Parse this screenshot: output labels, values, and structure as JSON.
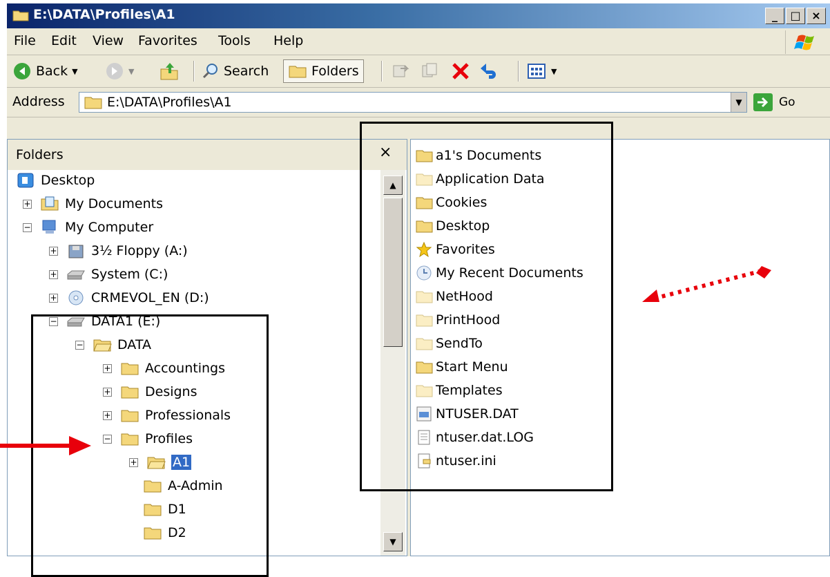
{
  "window": {
    "title": "E:\\DATA\\Profiles\\A1",
    "controls": {
      "minimize": "_",
      "maximize": "□",
      "close": "×"
    }
  },
  "menu": [
    "File",
    "Edit",
    "View",
    "Favorites",
    "Tools",
    "Help"
  ],
  "toolbar": {
    "back_label": "Back",
    "search_label": "Search",
    "folders_label": "Folders"
  },
  "address": {
    "label": "Address",
    "value": "E:\\DATA\\Profiles\\A1",
    "go_label": "Go"
  },
  "folder_pane": {
    "title": "Folders",
    "close": "×",
    "tree": [
      {
        "label": "Desktop",
        "icon": "desktop-icon",
        "expander": ""
      },
      {
        "label": "My Documents",
        "icon": "my-documents-icon",
        "expander": "+"
      },
      {
        "label": "My Computer",
        "icon": "my-computer-icon",
        "expander": "−"
      },
      {
        "label": "3½ Floppy (A:)",
        "icon": "floppy-icon",
        "expander": "+"
      },
      {
        "label": "System (C:)",
        "icon": "drive-icon",
        "expander": "+"
      },
      {
        "label": "CRMEVOL_EN (D:)",
        "icon": "cd-drive-icon",
        "expander": "+"
      },
      {
        "label": "DATA1 (E:)",
        "icon": "drive-icon",
        "expander": "−"
      },
      {
        "label": "DATA",
        "icon": "open-folder-icon",
        "expander": "−"
      },
      {
        "label": "Accountings",
        "icon": "folder-icon",
        "expander": "+"
      },
      {
        "label": "Designs",
        "icon": "folder-icon",
        "expander": "+"
      },
      {
        "label": "Professionals",
        "icon": "folder-icon",
        "expander": "+"
      },
      {
        "label": "Profiles",
        "icon": "folder-icon",
        "expander": "−"
      },
      {
        "label": "A1",
        "icon": "open-folder-icon",
        "expander": "+",
        "selected": true
      },
      {
        "label": "A-Admin",
        "icon": "folder-icon",
        "expander": ""
      },
      {
        "label": "D1",
        "icon": "folder-icon",
        "expander": ""
      },
      {
        "label": "D2",
        "icon": "folder-icon",
        "expander": ""
      }
    ]
  },
  "files": [
    {
      "name": "a1's Documents",
      "icon": "folder-icon"
    },
    {
      "name": "Application Data",
      "icon": "hidden-folder-icon"
    },
    {
      "name": "Cookies",
      "icon": "folder-icon"
    },
    {
      "name": "Desktop",
      "icon": "folder-icon"
    },
    {
      "name": "Favorites",
      "icon": "favorites-star-icon"
    },
    {
      "name": "My Recent Documents",
      "icon": "recent-documents-icon"
    },
    {
      "name": "NetHood",
      "icon": "hidden-folder-icon"
    },
    {
      "name": "PrintHood",
      "icon": "hidden-folder-icon"
    },
    {
      "name": "SendTo",
      "icon": "hidden-folder-icon"
    },
    {
      "name": "Start Menu",
      "icon": "folder-icon"
    },
    {
      "name": "Templates",
      "icon": "hidden-folder-icon"
    },
    {
      "name": "NTUSER.DAT",
      "icon": "system-file-icon"
    },
    {
      "name": "ntuser.dat.LOG",
      "icon": "text-file-icon"
    },
    {
      "name": "ntuser.ini",
      "icon": "ini-file-icon"
    }
  ],
  "colors": {
    "annotation_red": "#e8000b",
    "selection": "#316ac5",
    "folder": "#f4d77b"
  }
}
